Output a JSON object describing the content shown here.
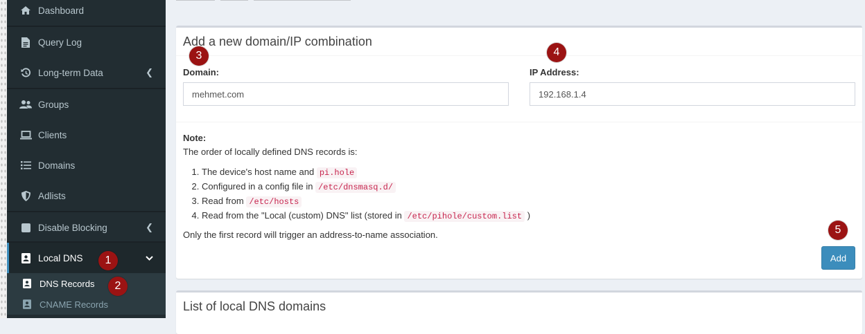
{
  "sidebar": {
    "items": [
      {
        "label": "Dashboard",
        "icon": "home-icon"
      },
      {
        "label": "Query Log",
        "icon": "file-icon"
      },
      {
        "label": "Long-term Data",
        "icon": "history-icon"
      },
      {
        "label": "Groups",
        "icon": "users-icon"
      },
      {
        "label": "Clients",
        "icon": "laptop-icon"
      },
      {
        "label": "Domains",
        "icon": "list-icon"
      },
      {
        "label": "Adlists",
        "icon": "shield-icon"
      },
      {
        "label": "Disable Blocking",
        "icon": "stop-icon"
      },
      {
        "label": "Local DNS",
        "icon": "address-book-icon"
      }
    ],
    "submenu": [
      {
        "label": "DNS Records",
        "icon": "address-book-icon"
      },
      {
        "label": "CNAME Records",
        "icon": "address-book-icon"
      }
    ]
  },
  "badges": [
    "1",
    "2",
    "3",
    "4",
    "5"
  ],
  "form": {
    "title": "Add a new domain/IP combination",
    "domain_label": "Domain:",
    "domain_value": "mehmet.com",
    "ip_label": "IP Address:",
    "ip_value": "192.168.1.4",
    "note_label": "Note:",
    "note_intro": "The order of locally defined DNS records is:",
    "records": [
      {
        "text": "The device's host name and",
        "code": "pi.hole",
        "after": ""
      },
      {
        "text": "Configured in a config file in",
        "code": "/etc/dnsmasq.d/",
        "after": ""
      },
      {
        "text": "Read from",
        "code": "/etc/hosts",
        "after": ""
      },
      {
        "text": "Read from the \"Local (custom) DNS\" list (stored in",
        "code": "/etc/pihole/custom.list",
        "after": ")"
      }
    ],
    "footer_note": "Only the first record will trigger an address-to-name association.",
    "add_button": "Add"
  },
  "list_box": {
    "title": "List of local DNS domains"
  },
  "colors": {
    "sidebar_bg": "#222d32",
    "accent": "#3c8dbc",
    "badge": "#9b1313",
    "code": "#c7254e"
  }
}
